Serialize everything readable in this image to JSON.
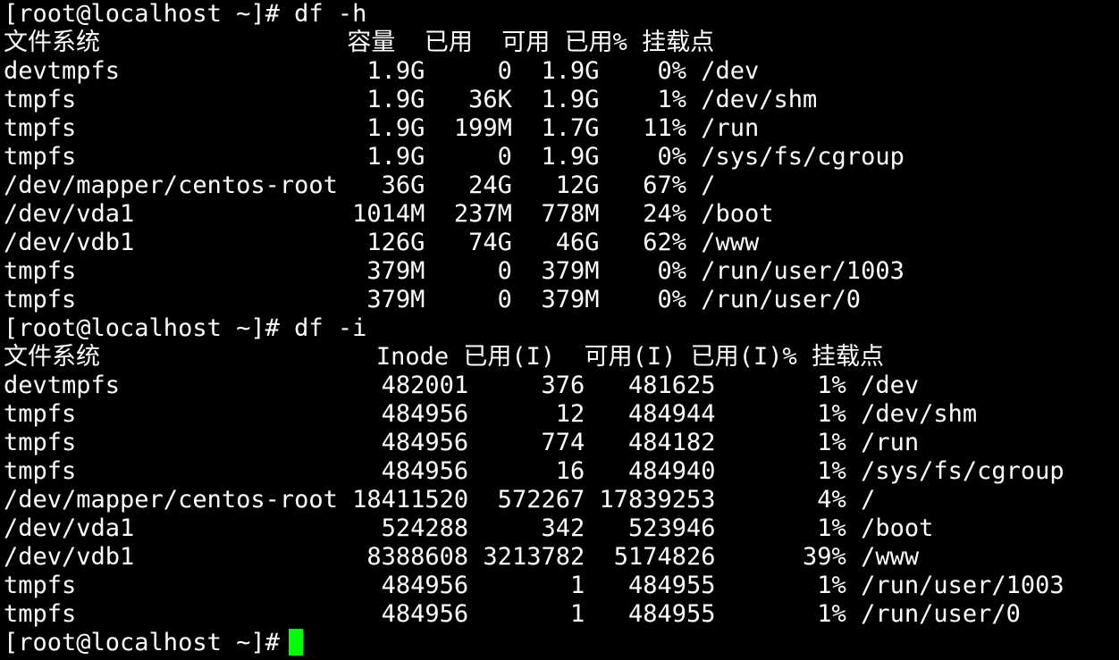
{
  "terminal": {
    "background": "#000000",
    "foreground": "#ffffff",
    "cursor_color": "#00ff00",
    "lines": [
      "[root@localhost ~]# df -h",
      "文件系统                 容量  已用  可用 已用% 挂载点",
      "devtmpfs                 1.9G     0  1.9G    0% /dev",
      "tmpfs                    1.9G   36K  1.9G    1% /dev/shm",
      "tmpfs                    1.9G  199M  1.7G   11% /run",
      "tmpfs                    1.9G     0  1.9G    0% /sys/fs/cgroup",
      "/dev/mapper/centos-root   36G   24G   12G   67% /",
      "/dev/vda1               1014M  237M  778M   24% /boot",
      "/dev/vdb1                126G   74G   46G   62% /www",
      "tmpfs                    379M     0  379M    0% /run/user/1003",
      "tmpfs                    379M     0  379M    0% /run/user/0",
      "[root@localhost ~]# df -i",
      "文件系统                   Inode 已用(I)  可用(I) 已用(I)% 挂载点",
      "devtmpfs                  482001     376   481625       1% /dev",
      "tmpfs                     484956      12   484944       1% /dev/shm",
      "tmpfs                     484956     774   484182       1% /run",
      "tmpfs                     484956      16   484940       1% /sys/fs/cgroup",
      "/dev/mapper/centos-root 18411520  572267 17839253       4% /",
      "/dev/vda1                 524288     342   523946       1% /boot",
      "/dev/vdb1                8388608 3213782  5174826      39% /www",
      "tmpfs                     484956       1   484955       1% /run/user/1003",
      "tmpfs                     484956       1   484955       1% /run/user/0",
      "[root@localhost ~]# "
    ]
  }
}
